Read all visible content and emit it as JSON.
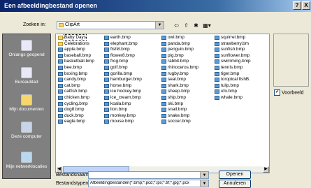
{
  "window": {
    "title": "Een afbeeldingbestand openen",
    "help_button": "?",
    "close_button": "X"
  },
  "location": {
    "label": "Zoeken in:",
    "value": "ClipArt"
  },
  "toolbar": {
    "back": "⇦",
    "up": "⇧",
    "new_folder": "✱",
    "view_menu": "▦▾"
  },
  "places": [
    {
      "label": "Onlangs geopend",
      "icon": "recent-icon"
    },
    {
      "label": "Bureaublad",
      "icon": "desktop-icon"
    },
    {
      "label": "Mijn documenten",
      "icon": "documents-icon"
    },
    {
      "label": "Deze computer",
      "icon": "computer-icon"
    },
    {
      "label": "Mijn netwerklocaties",
      "icon": "network-icon"
    }
  ],
  "files": [
    [
      "Baby Days",
      "Celebrations",
      "apple.bmp",
      "baseball.bmp",
      "basketball.bmp",
      "bee.bmp",
      "boxing.bmp",
      "candy.bmp",
      "cat.bmp",
      "catfish.bmp",
      "chicken.bmp",
      "cycling.bmp",
      "dog8.bmp",
      "duck.bmp",
      "eagle.bmp"
    ],
    [
      "earth.bmp",
      "elephant.bmp",
      "fish8.bmp",
      "flower8.bmp",
      "frog.bmp",
      "golf.bmp",
      "gorilla.bmp",
      "hamburger.bmp",
      "horse.bmp",
      "ice hockey.bmp",
      "ice_cream.bmp",
      "koala.bmp",
      "lion.bmp",
      "monkey.bmp",
      "mouse.bmp"
    ],
    [
      "owl.bmp",
      "panda.bmp",
      "penguin.bmp",
      "pig.bmp",
      "rabbit.bmp",
      "rhinoceros.bmp",
      "rugby.bmp",
      "seal.bmp",
      "shark.bmp",
      "sheep.bmp",
      "ship.bmp",
      "ski.bmp",
      "snail.bmp",
      "snake.bmp",
      "soccer.bmp"
    ],
    [
      "squirrel.bmp",
      "strawberry.bm",
      "sunfish.bmp",
      "sunflower.bmp",
      "swimming.bmp",
      "tennis.bmp",
      "tiger.bmp",
      "toropical fishB.",
      "tulip.bmp",
      "ufo.bmp",
      "whale.bmp"
    ]
  ],
  "preview_checkbox": {
    "label": "Voorbeeld",
    "checked": true
  },
  "filename": {
    "label": "Bestandsnaam:",
    "value": ""
  },
  "filetype": {
    "label": "Bestandstypen:",
    "value": "Afbeeldingbestanden(*.bmp;*.pcd;*.lpx;*.tif;*.jpg;*.pcx"
  },
  "buttons": {
    "open": "Openen",
    "cancel": "Annuleren"
  }
}
